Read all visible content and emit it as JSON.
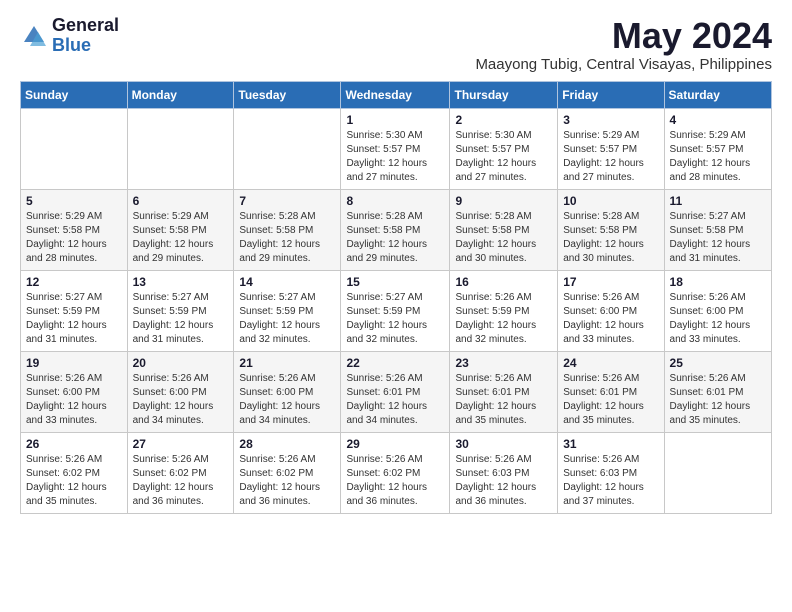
{
  "header": {
    "logo_general": "General",
    "logo_blue": "Blue",
    "month_title": "May 2024",
    "location": "Maayong Tubig, Central Visayas, Philippines"
  },
  "days_of_week": [
    "Sunday",
    "Monday",
    "Tuesday",
    "Wednesday",
    "Thursday",
    "Friday",
    "Saturday"
  ],
  "weeks": [
    [
      {
        "day": "",
        "sunrise": "",
        "sunset": "",
        "daylight": ""
      },
      {
        "day": "",
        "sunrise": "",
        "sunset": "",
        "daylight": ""
      },
      {
        "day": "",
        "sunrise": "",
        "sunset": "",
        "daylight": ""
      },
      {
        "day": "1",
        "sunrise": "Sunrise: 5:30 AM",
        "sunset": "Sunset: 5:57 PM",
        "daylight": "Daylight: 12 hours and 27 minutes."
      },
      {
        "day": "2",
        "sunrise": "Sunrise: 5:30 AM",
        "sunset": "Sunset: 5:57 PM",
        "daylight": "Daylight: 12 hours and 27 minutes."
      },
      {
        "day": "3",
        "sunrise": "Sunrise: 5:29 AM",
        "sunset": "Sunset: 5:57 PM",
        "daylight": "Daylight: 12 hours and 27 minutes."
      },
      {
        "day": "4",
        "sunrise": "Sunrise: 5:29 AM",
        "sunset": "Sunset: 5:57 PM",
        "daylight": "Daylight: 12 hours and 28 minutes."
      }
    ],
    [
      {
        "day": "5",
        "sunrise": "Sunrise: 5:29 AM",
        "sunset": "Sunset: 5:58 PM",
        "daylight": "Daylight: 12 hours and 28 minutes."
      },
      {
        "day": "6",
        "sunrise": "Sunrise: 5:29 AM",
        "sunset": "Sunset: 5:58 PM",
        "daylight": "Daylight: 12 hours and 29 minutes."
      },
      {
        "day": "7",
        "sunrise": "Sunrise: 5:28 AM",
        "sunset": "Sunset: 5:58 PM",
        "daylight": "Daylight: 12 hours and 29 minutes."
      },
      {
        "day": "8",
        "sunrise": "Sunrise: 5:28 AM",
        "sunset": "Sunset: 5:58 PM",
        "daylight": "Daylight: 12 hours and 29 minutes."
      },
      {
        "day": "9",
        "sunrise": "Sunrise: 5:28 AM",
        "sunset": "Sunset: 5:58 PM",
        "daylight": "Daylight: 12 hours and 30 minutes."
      },
      {
        "day": "10",
        "sunrise": "Sunrise: 5:28 AM",
        "sunset": "Sunset: 5:58 PM",
        "daylight": "Daylight: 12 hours and 30 minutes."
      },
      {
        "day": "11",
        "sunrise": "Sunrise: 5:27 AM",
        "sunset": "Sunset: 5:58 PM",
        "daylight": "Daylight: 12 hours and 31 minutes."
      }
    ],
    [
      {
        "day": "12",
        "sunrise": "Sunrise: 5:27 AM",
        "sunset": "Sunset: 5:59 PM",
        "daylight": "Daylight: 12 hours and 31 minutes."
      },
      {
        "day": "13",
        "sunrise": "Sunrise: 5:27 AM",
        "sunset": "Sunset: 5:59 PM",
        "daylight": "Daylight: 12 hours and 31 minutes."
      },
      {
        "day": "14",
        "sunrise": "Sunrise: 5:27 AM",
        "sunset": "Sunset: 5:59 PM",
        "daylight": "Daylight: 12 hours and 32 minutes."
      },
      {
        "day": "15",
        "sunrise": "Sunrise: 5:27 AM",
        "sunset": "Sunset: 5:59 PM",
        "daylight": "Daylight: 12 hours and 32 minutes."
      },
      {
        "day": "16",
        "sunrise": "Sunrise: 5:26 AM",
        "sunset": "Sunset: 5:59 PM",
        "daylight": "Daylight: 12 hours and 32 minutes."
      },
      {
        "day": "17",
        "sunrise": "Sunrise: 5:26 AM",
        "sunset": "Sunset: 6:00 PM",
        "daylight": "Daylight: 12 hours and 33 minutes."
      },
      {
        "day": "18",
        "sunrise": "Sunrise: 5:26 AM",
        "sunset": "Sunset: 6:00 PM",
        "daylight": "Daylight: 12 hours and 33 minutes."
      }
    ],
    [
      {
        "day": "19",
        "sunrise": "Sunrise: 5:26 AM",
        "sunset": "Sunset: 6:00 PM",
        "daylight": "Daylight: 12 hours and 33 minutes."
      },
      {
        "day": "20",
        "sunrise": "Sunrise: 5:26 AM",
        "sunset": "Sunset: 6:00 PM",
        "daylight": "Daylight: 12 hours and 34 minutes."
      },
      {
        "day": "21",
        "sunrise": "Sunrise: 5:26 AM",
        "sunset": "Sunset: 6:00 PM",
        "daylight": "Daylight: 12 hours and 34 minutes."
      },
      {
        "day": "22",
        "sunrise": "Sunrise: 5:26 AM",
        "sunset": "Sunset: 6:01 PM",
        "daylight": "Daylight: 12 hours and 34 minutes."
      },
      {
        "day": "23",
        "sunrise": "Sunrise: 5:26 AM",
        "sunset": "Sunset: 6:01 PM",
        "daylight": "Daylight: 12 hours and 35 minutes."
      },
      {
        "day": "24",
        "sunrise": "Sunrise: 5:26 AM",
        "sunset": "Sunset: 6:01 PM",
        "daylight": "Daylight: 12 hours and 35 minutes."
      },
      {
        "day": "25",
        "sunrise": "Sunrise: 5:26 AM",
        "sunset": "Sunset: 6:01 PM",
        "daylight": "Daylight: 12 hours and 35 minutes."
      }
    ],
    [
      {
        "day": "26",
        "sunrise": "Sunrise: 5:26 AM",
        "sunset": "Sunset: 6:02 PM",
        "daylight": "Daylight: 12 hours and 35 minutes."
      },
      {
        "day": "27",
        "sunrise": "Sunrise: 5:26 AM",
        "sunset": "Sunset: 6:02 PM",
        "daylight": "Daylight: 12 hours and 36 minutes."
      },
      {
        "day": "28",
        "sunrise": "Sunrise: 5:26 AM",
        "sunset": "Sunset: 6:02 PM",
        "daylight": "Daylight: 12 hours and 36 minutes."
      },
      {
        "day": "29",
        "sunrise": "Sunrise: 5:26 AM",
        "sunset": "Sunset: 6:02 PM",
        "daylight": "Daylight: 12 hours and 36 minutes."
      },
      {
        "day": "30",
        "sunrise": "Sunrise: 5:26 AM",
        "sunset": "Sunset: 6:03 PM",
        "daylight": "Daylight: 12 hours and 36 minutes."
      },
      {
        "day": "31",
        "sunrise": "Sunrise: 5:26 AM",
        "sunset": "Sunset: 6:03 PM",
        "daylight": "Daylight: 12 hours and 37 minutes."
      },
      {
        "day": "",
        "sunrise": "",
        "sunset": "",
        "daylight": ""
      }
    ]
  ]
}
